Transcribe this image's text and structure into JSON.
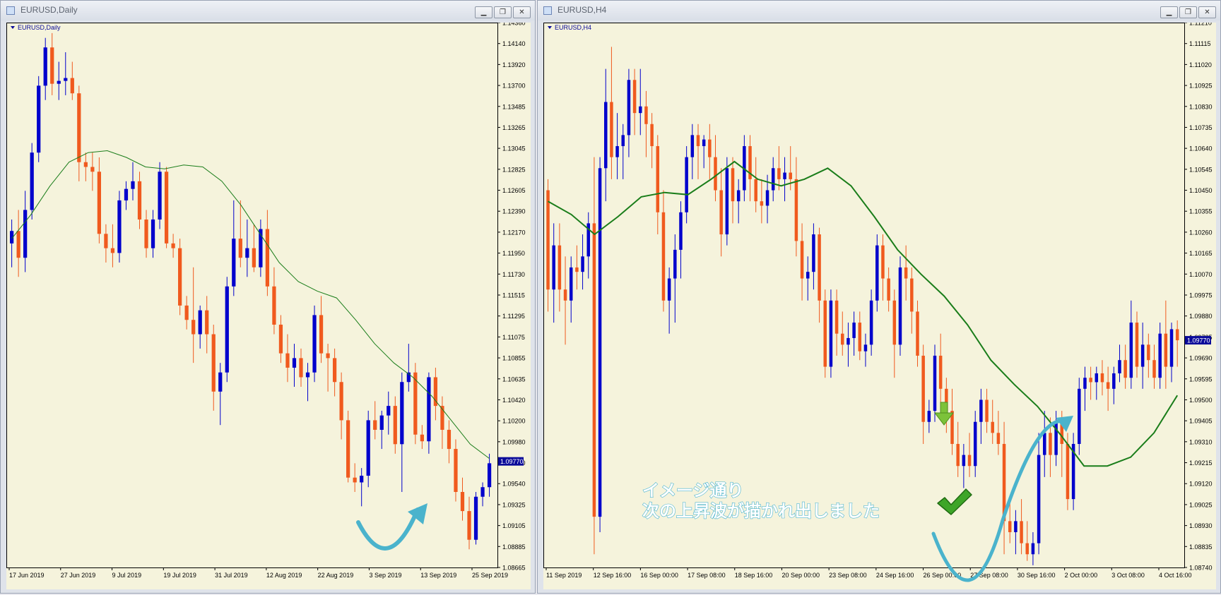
{
  "windows": [
    {
      "title": "EURUSD,Daily",
      "controls": [
        "▁",
        "❐",
        "✕"
      ]
    },
    {
      "title": "EURUSD,H4",
      "controls": [
        "▁",
        "❐",
        "✕"
      ]
    }
  ],
  "annotation": {
    "line1": "イメージ通り",
    "line2": "次の上昇波が描かれ出しました"
  },
  "colors": {
    "background": "#f5f3dc",
    "bull": "#0000cc",
    "bear": "#f05a1e",
    "ma": "#1a7d1a",
    "arrow": "#4ab3cc",
    "price_label": "#0a0a99"
  },
  "icons": [
    "window-icon",
    "minimize-icon",
    "restore-icon",
    "close-icon",
    "down-arrow-icon",
    "check-mark-icon",
    "dropdown-triangle-icon"
  ],
  "chart_data": [
    {
      "type": "candlestick",
      "symbol_label": "EURUSD,Daily",
      "ylim": [
        1.0866,
        1.1436
      ],
      "y_ticks": [
        "1.14360",
        "1.14140",
        "1.13920",
        "1.13700",
        "1.13485",
        "1.13265",
        "1.13045",
        "1.12825",
        "1.12605",
        "1.12390",
        "1.12170",
        "1.11950",
        "1.11730",
        "1.11515",
        "1.11295",
        "1.11075",
        "1.10855",
        "1.10635",
        "1.10420",
        "1.10200",
        "1.09980",
        "1.09760",
        "1.09540",
        "1.09325",
        "1.09105",
        "1.08885",
        "1.08665"
      ],
      "x_ticks": [
        "17 Jun 2019",
        "27 Jun 2019",
        "9 Jul 2019",
        "19 Jul 2019",
        "31 Jul 2019",
        "12 Aug 2019",
        "22 Aug 2019",
        "3 Sep 2019",
        "13 Sep 2019",
        "25 Sep 2019"
      ],
      "current_price": "1.09770",
      "ohlc": [
        [
          1.1205,
          1.123,
          1.118,
          1.1218
        ],
        [
          1.1218,
          1.124,
          1.117,
          1.119
        ],
        [
          1.119,
          1.126,
          1.1175,
          1.124
        ],
        [
          1.124,
          1.131,
          1.123,
          1.13
        ],
        [
          1.13,
          1.138,
          1.129,
          1.137
        ],
        [
          1.137,
          1.142,
          1.1355,
          1.141
        ],
        [
          1.141,
          1.1425,
          1.136,
          1.1372
        ],
        [
          1.1372,
          1.1395,
          1.1355,
          1.1375
        ],
        [
          1.1375,
          1.1405,
          1.136,
          1.1378
        ],
        [
          1.1378,
          1.1395,
          1.1355,
          1.1362
        ],
        [
          1.1362,
          1.137,
          1.127,
          1.129
        ],
        [
          1.129,
          1.13,
          1.127,
          1.1285
        ],
        [
          1.1285,
          1.13,
          1.126,
          1.128
        ],
        [
          1.128,
          1.1295,
          1.1205,
          1.1215
        ],
        [
          1.1215,
          1.1225,
          1.1185,
          1.12
        ],
        [
          1.12,
          1.1225,
          1.118,
          1.1195
        ],
        [
          1.1195,
          1.126,
          1.1185,
          1.125
        ],
        [
          1.125,
          1.127,
          1.124,
          1.1262
        ],
        [
          1.1262,
          1.129,
          1.125,
          1.127
        ],
        [
          1.127,
          1.128,
          1.122,
          1.123
        ],
        [
          1.123,
          1.124,
          1.119,
          1.12
        ],
        [
          1.12,
          1.124,
          1.119,
          1.123
        ],
        [
          1.123,
          1.129,
          1.122,
          1.128
        ],
        [
          1.128,
          1.1285,
          1.12,
          1.1205
        ],
        [
          1.1205,
          1.1215,
          1.119,
          1.12
        ],
        [
          1.12,
          1.121,
          1.113,
          1.114
        ],
        [
          1.114,
          1.115,
          1.1115,
          1.1125
        ],
        [
          1.1125,
          1.118,
          1.108,
          1.111
        ],
        [
          1.111,
          1.114,
          1.1095,
          1.1135
        ],
        [
          1.1135,
          1.115,
          1.109,
          1.111
        ],
        [
          1.111,
          1.112,
          1.103,
          1.105
        ],
        [
          1.105,
          1.108,
          1.1015,
          1.107
        ],
        [
          1.107,
          1.117,
          1.106,
          1.116
        ],
        [
          1.116,
          1.125,
          1.115,
          1.121
        ],
        [
          1.121,
          1.125,
          1.118,
          1.119
        ],
        [
          1.119,
          1.123,
          1.117,
          1.12
        ],
        [
          1.12,
          1.1225,
          1.1175,
          1.118
        ],
        [
          1.118,
          1.123,
          1.117,
          1.122
        ],
        [
          1.122,
          1.124,
          1.115,
          1.116
        ],
        [
          1.116,
          1.118,
          1.111,
          1.112
        ],
        [
          1.112,
          1.113,
          1.108,
          1.109
        ],
        [
          1.109,
          1.111,
          1.106,
          1.1075
        ],
        [
          1.1075,
          1.11,
          1.1055,
          1.1085
        ],
        [
          1.1085,
          1.1095,
          1.1055,
          1.1065
        ],
        [
          1.1065,
          1.108,
          1.104,
          1.107
        ],
        [
          1.107,
          1.114,
          1.106,
          1.113
        ],
        [
          1.113,
          1.115,
          1.108,
          1.109
        ],
        [
          1.109,
          1.11,
          1.105,
          1.1085
        ],
        [
          1.1085,
          1.1095,
          1.1045,
          1.106
        ],
        [
          1.106,
          1.107,
          1.1,
          1.102
        ],
        [
          1.102,
          1.103,
          1.0955,
          1.096
        ],
        [
          1.096,
          1.0975,
          1.0945,
          1.0955
        ],
        [
          1.0955,
          1.097,
          1.093,
          1.0962
        ],
        [
          1.0962,
          1.103,
          1.095,
          1.102
        ],
        [
          1.102,
          1.104,
          1.1,
          1.101
        ],
        [
          1.101,
          1.103,
          1.099,
          1.1025
        ],
        [
          1.1025,
          1.105,
          1.1005,
          1.1035
        ],
        [
          1.1035,
          1.1045,
          1.0985,
          1.0995
        ],
        [
          1.0995,
          1.107,
          1.0945,
          1.106
        ],
        [
          1.106,
          1.11,
          1.105,
          1.107
        ],
        [
          1.107,
          1.108,
          1.0995,
          1.1005
        ],
        [
          1.1005,
          1.1015,
          1.099,
          1.0998
        ],
        [
          1.0998,
          1.107,
          1.0985,
          1.1065
        ],
        [
          1.1065,
          1.1075,
          1.102,
          1.1035
        ],
        [
          1.1035,
          1.1045,
          1.099,
          1.101
        ],
        [
          1.101,
          1.102,
          1.0975,
          1.099
        ],
        [
          1.099,
          1.1,
          1.0935,
          1.0945
        ],
        [
          1.0945,
          1.096,
          1.0915,
          1.0925
        ],
        [
          1.0925,
          1.094,
          1.0885,
          1.0895
        ],
        [
          1.0895,
          1.0945,
          1.089,
          1.094
        ],
        [
          1.094,
          1.0955,
          1.093,
          1.095
        ],
        [
          1.095,
          1.0985,
          1.094,
          1.0975
        ]
      ],
      "ma": [
        1.121,
        1.1235,
        1.1265,
        1.129,
        1.13,
        1.1302,
        1.1295,
        1.1285,
        1.1283,
        1.1287,
        1.1285,
        1.127,
        1.1245,
        1.1215,
        1.1185,
        1.1165,
        1.1155,
        1.1148,
        1.1125,
        1.11,
        1.108,
        1.1065,
        1.1045,
        1.102,
        1.0995,
        1.098
      ]
    },
    {
      "type": "candlestick",
      "symbol_label": "EURUSD,H4",
      "ylim": [
        1.0874,
        1.1121
      ],
      "y_ticks": [
        "1.11210",
        "1.11115",
        "1.11020",
        "1.10925",
        "1.10830",
        "1.10735",
        "1.10640",
        "1.10545",
        "1.10450",
        "1.10355",
        "1.10260",
        "1.10165",
        "1.10070",
        "1.09975",
        "1.09880",
        "1.09785",
        "1.09690",
        "1.09595",
        "1.09500",
        "1.09405",
        "1.09310",
        "1.09215",
        "1.09120",
        "1.09025",
        "1.08930",
        "1.08835",
        "1.08740"
      ],
      "x_ticks": [
        "11 Sep 2019",
        "12 Sep 16:00",
        "16 Sep 00:00",
        "17 Sep 08:00",
        "18 Sep 16:00",
        "20 Sep 00:00",
        "23 Sep 08:00",
        "24 Sep 16:00",
        "26 Sep 00:00",
        "27 Sep 08:00",
        "30 Sep 16:00",
        "2 Oct 00:00",
        "3 Oct 08:00",
        "4 Oct 16:00"
      ],
      "current_price": "1.09770",
      "ohlc": [
        [
          1.1045,
          1.105,
          1.099,
          1.1
        ],
        [
          1.1,
          1.103,
          1.0985,
          1.102
        ],
        [
          1.102,
          1.103,
          1.099,
          1.1
        ],
        [
          1.1,
          1.1015,
          1.0975,
          1.0995
        ],
        [
          1.0995,
          1.1015,
          1.0985,
          1.101
        ],
        [
          1.101,
          1.102,
          1.1,
          1.1008
        ],
        [
          1.1008,
          1.1025,
          1.1,
          1.1015
        ],
        [
          1.1015,
          1.1035,
          1.1005,
          1.103
        ],
        [
          1.103,
          1.106,
          1.088,
          1.0897
        ],
        [
          1.0897,
          1.106,
          1.089,
          1.1055
        ],
        [
          1.1055,
          1.11,
          1.104,
          1.1085
        ],
        [
          1.1085,
          1.111,
          1.105,
          1.106
        ],
        [
          1.106,
          1.108,
          1.105,
          1.1065
        ],
        [
          1.1065,
          1.1075,
          1.105,
          1.107
        ],
        [
          1.107,
          1.11,
          1.106,
          1.1095
        ],
        [
          1.1095,
          1.11,
          1.107,
          1.108
        ],
        [
          1.108,
          1.11,
          1.107,
          1.1083
        ],
        [
          1.1083,
          1.109,
          1.106,
          1.1075
        ],
        [
          1.1075,
          1.108,
          1.1055,
          1.1065
        ],
        [
          1.1065,
          1.107,
          1.1025,
          1.1035
        ],
        [
          1.1035,
          1.1045,
          1.099,
          1.0995
        ],
        [
          1.0995,
          1.101,
          1.098,
          1.1005
        ],
        [
          1.1005,
          1.1025,
          1.0985,
          1.1018
        ],
        [
          1.1018,
          1.104,
          1.1005,
          1.1035
        ],
        [
          1.1035,
          1.1065,
          1.103,
          1.106
        ],
        [
          1.106,
          1.1075,
          1.105,
          1.107
        ],
        [
          1.107,
          1.1075,
          1.105,
          1.1065
        ],
        [
          1.1065,
          1.107,
          1.1055,
          1.1068
        ],
        [
          1.1068,
          1.1075,
          1.105,
          1.106
        ],
        [
          1.106,
          1.107,
          1.104,
          1.1045
        ],
        [
          1.1045,
          1.1055,
          1.1015,
          1.1025
        ],
        [
          1.1025,
          1.106,
          1.102,
          1.1055
        ],
        [
          1.1055,
          1.106,
          1.103,
          1.104
        ],
        [
          1.104,
          1.105,
          1.103,
          1.1045
        ],
        [
          1.1045,
          1.107,
          1.104,
          1.1065
        ],
        [
          1.1065,
          1.107,
          1.104,
          1.105
        ],
        [
          1.105,
          1.106,
          1.1035,
          1.104
        ],
        [
          1.104,
          1.105,
          1.103,
          1.1038
        ],
        [
          1.1038,
          1.1052,
          1.103,
          1.1045
        ],
        [
          1.1045,
          1.106,
          1.104,
          1.1055
        ],
        [
          1.1055,
          1.1065,
          1.1045,
          1.105
        ],
        [
          1.105,
          1.106,
          1.104,
          1.1053
        ],
        [
          1.1053,
          1.1065,
          1.1045,
          1.105
        ],
        [
          1.105,
          1.106,
          1.1015,
          1.1022
        ],
        [
          1.1022,
          1.103,
          1.0995,
          1.1005
        ],
        [
          1.1005,
          1.1015,
          1.0995,
          1.1008
        ],
        [
          1.1008,
          1.103,
          1.1,
          1.1025
        ],
        [
          1.1025,
          1.1028,
          1.0985,
          1.0995
        ],
        [
          1.0995,
          1.1,
          1.096,
          1.0965
        ],
        [
          1.0965,
          1.1,
          1.096,
          1.0995
        ],
        [
          1.0995,
          1.1,
          1.097,
          1.098
        ],
        [
          1.098,
          1.099,
          1.097,
          1.0975
        ],
        [
          1.0975,
          1.0985,
          1.0965,
          1.0978
        ],
        [
          1.0978,
          1.099,
          1.097,
          1.0985
        ],
        [
          1.0985,
          1.099,
          1.0968,
          1.0972
        ],
        [
          1.0972,
          1.098,
          1.0965,
          1.0975
        ],
        [
          1.0975,
          1.1,
          1.097,
          1.0995
        ],
        [
          1.0995,
          1.1025,
          1.099,
          1.102
        ],
        [
          1.102,
          1.1025,
          1.0995,
          1.1005
        ],
        [
          1.1005,
          1.101,
          1.099,
          1.0995
        ],
        [
          1.0995,
          1.1,
          1.096,
          1.0975
        ],
        [
          1.0975,
          1.1015,
          1.097,
          1.101
        ],
        [
          1.101,
          1.102,
          1.0995,
          1.1005
        ],
        [
          1.1005,
          1.101,
          1.098,
          1.099
        ],
        [
          1.099,
          1.0995,
          1.0965,
          1.097
        ],
        [
          1.097,
          1.0975,
          1.093,
          1.094
        ],
        [
          1.094,
          1.095,
          1.0935,
          1.0945
        ],
        [
          1.0945,
          1.0975,
          1.094,
          1.097
        ],
        [
          1.097,
          1.098,
          1.0945,
          1.0955
        ],
        [
          1.0955,
          1.096,
          1.0935,
          1.0945
        ],
        [
          1.0945,
          1.0955,
          1.0925,
          1.093
        ],
        [
          1.093,
          1.094,
          1.0915,
          1.092
        ],
        [
          1.092,
          1.093,
          1.091,
          1.0925
        ],
        [
          1.0925,
          1.0935,
          1.0915,
          1.092
        ],
        [
          1.092,
          1.0945,
          1.0915,
          1.094
        ],
        [
          1.094,
          1.0955,
          1.093,
          1.095
        ],
        [
          1.095,
          1.0955,
          1.0935,
          1.094
        ],
        [
          1.094,
          1.095,
          1.093,
          1.0935
        ],
        [
          1.0935,
          1.0945,
          1.0925,
          1.093
        ],
        [
          1.093,
          1.094,
          1.088,
          1.0895
        ],
        [
          1.0895,
          1.0905,
          1.0885,
          1.089
        ],
        [
          1.089,
          1.09,
          1.088,
          1.0895
        ],
        [
          1.0895,
          1.0905,
          1.088,
          1.0885
        ],
        [
          1.0885,
          1.0895,
          1.0877,
          1.088
        ],
        [
          1.088,
          1.089,
          1.0875,
          1.0885
        ],
        [
          1.0885,
          1.0935,
          1.088,
          1.0925
        ],
        [
          1.0925,
          1.0945,
          1.0915,
          1.0935
        ],
        [
          1.0935,
          1.0942,
          1.0915,
          1.0925
        ],
        [
          1.0925,
          1.0945,
          1.092,
          1.094
        ],
        [
          1.094,
          1.0945,
          1.0915,
          1.093
        ],
        [
          1.093,
          1.0935,
          1.09,
          1.0905
        ],
        [
          1.0905,
          1.0935,
          1.09,
          1.093
        ],
        [
          1.093,
          1.096,
          1.0925,
          1.0955
        ],
        [
          1.0955,
          1.0965,
          1.0945,
          1.096
        ],
        [
          1.096,
          1.0965,
          1.095,
          1.0958
        ],
        [
          1.0958,
          1.0965,
          1.095,
          1.0962
        ],
        [
          1.0962,
          1.0968,
          1.0952,
          1.0958
        ],
        [
          1.0958,
          1.0965,
          1.0945,
          1.0955
        ],
        [
          1.0955,
          1.0965,
          1.0948,
          1.0962
        ],
        [
          1.0962,
          1.0975,
          1.0958,
          1.0968
        ],
        [
          1.0968,
          1.0975,
          1.0955,
          1.096
        ],
        [
          1.096,
          1.0995,
          1.0955,
          1.0985
        ],
        [
          1.0985,
          1.099,
          1.096,
          1.0965
        ],
        [
          1.0965,
          1.0985,
          1.0955,
          1.0975
        ],
        [
          1.0975,
          1.098,
          1.096,
          1.0968
        ],
        [
          1.0968,
          1.0975,
          1.0955,
          1.096
        ],
        [
          1.096,
          1.0985,
          1.0955,
          1.098
        ],
        [
          1.098,
          1.0995,
          1.0955,
          1.0965
        ],
        [
          1.0965,
          1.0985,
          1.0958,
          1.0982
        ],
        [
          1.0982,
          1.0986,
          1.0965,
          1.0977
        ]
      ],
      "ma": [
        1.104,
        1.1034,
        1.1025,
        1.1033,
        1.1042,
        1.1044,
        1.1043,
        1.105,
        1.1058,
        1.105,
        1.1047,
        1.105,
        1.1055,
        1.1047,
        1.1033,
        1.1018,
        1.1007,
        1.0997,
        1.0984,
        1.0968,
        1.0957,
        1.0947,
        1.0934,
        1.092,
        1.092,
        1.0924,
        1.0935,
        1.0952
      ]
    }
  ]
}
